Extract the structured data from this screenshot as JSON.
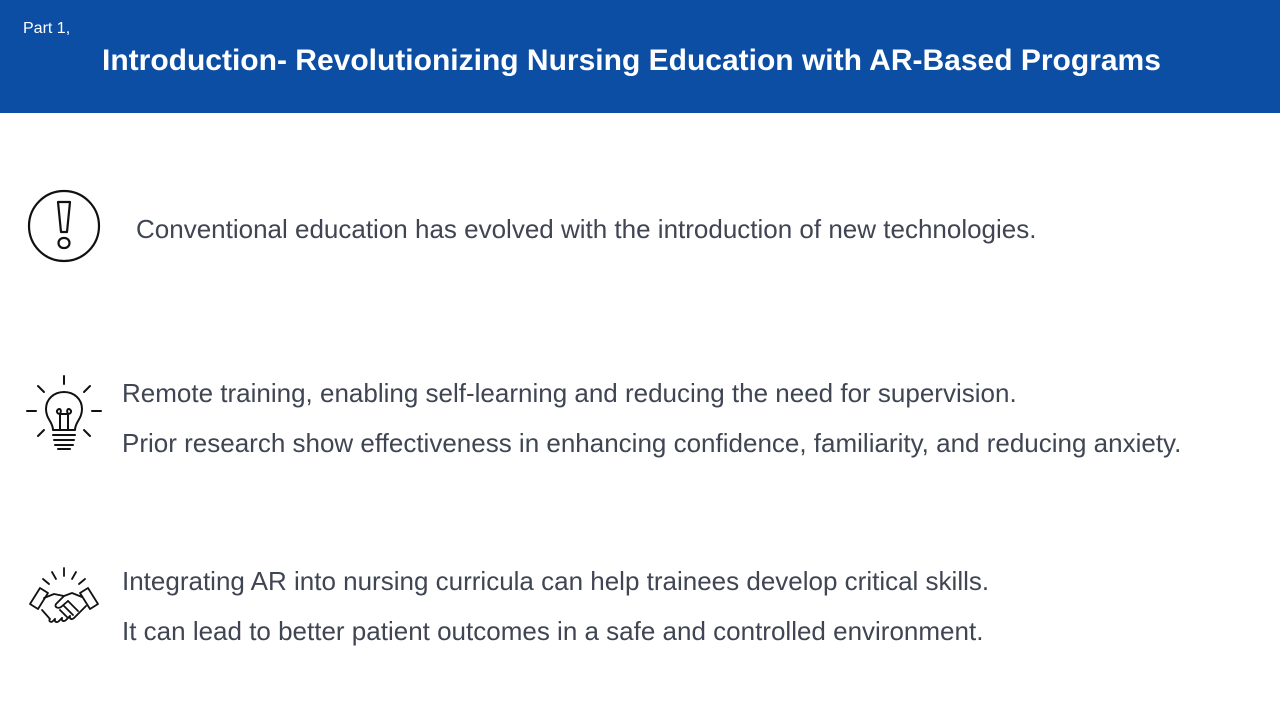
{
  "header": {
    "part": "Part 1,",
    "title": "Introduction- Revolutionizing Nursing Education with AR-Based Programs"
  },
  "sections": [
    {
      "icon": "exclamation-icon",
      "lines": [
        "Conventional education has evolved with the introduction of new technologies."
      ]
    },
    {
      "icon": "lightbulb-icon",
      "lines": [
        "Remote training, enabling self-learning and reducing the need for supervision.",
        "Prior research show effectiveness  in enhancing confidence, familiarity,  and reducing anxiety."
      ]
    },
    {
      "icon": "handshake-icon",
      "lines": [
        "Integrating AR into nursing curricula can help trainees develop critical skills.",
        "It can lead to better patient outcomes in a safe and controlled environment."
      ]
    }
  ],
  "colors": {
    "header_bg": "#0c4ea3",
    "body_text": "#3f4552",
    "icon_stroke": "#111111"
  }
}
